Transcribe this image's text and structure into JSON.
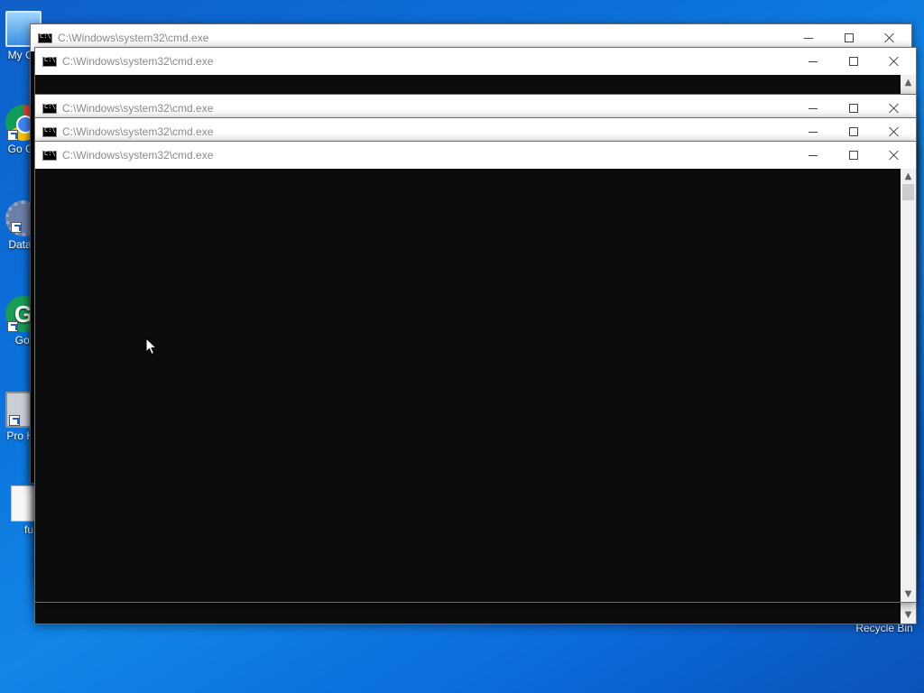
{
  "desktop": {
    "icons": [
      {
        "label": "My Co",
        "glyph": "monitor-icon"
      },
      {
        "label": "Go Ch",
        "glyph": "chrome-icon"
      },
      {
        "label": "DataV",
        "glyph": "gear-icon"
      },
      {
        "label": "Gol",
        "glyph": "gimp-icon"
      },
      {
        "label": "Pro Ha",
        "glyph": "computer-icon"
      },
      {
        "label": "fu",
        "glyph": "file-icon"
      }
    ],
    "recycle_bin_label": "Recycle Bin"
  },
  "windows": [
    {
      "title": "C:\\Windows\\system32\\cmd.exe"
    },
    {
      "title": "C:\\Windows\\system32\\cmd.exe"
    },
    {
      "title": "C:\\Windows\\system32\\cmd.exe"
    },
    {
      "title": "C:\\Windows\\system32\\cmd.exe"
    },
    {
      "title": "C:\\Windows\\system32\\cmd.exe"
    }
  ],
  "glyphs": {
    "scroll_up": "▲",
    "scroll_down": "▼",
    "gimp_letter": "G"
  },
  "colors": {
    "desktop": "#0b6fd8",
    "console_bg": "#0c0c0c",
    "titlebar": "#ffffff",
    "title_text": "#8a8a8a"
  }
}
